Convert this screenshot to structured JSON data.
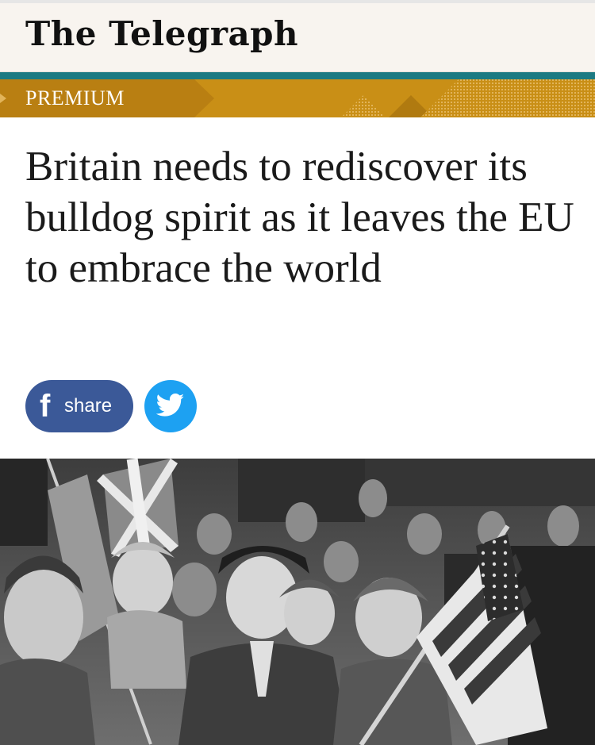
{
  "masthead": {
    "logo_text": "The Telegraph"
  },
  "badge": {
    "label": "PREMIUM"
  },
  "article": {
    "headline": "Britain needs to rediscover its bulldog spirit as it leaves the EU to embrace the world"
  },
  "share": {
    "facebook_icon": "f",
    "facebook_label": "share",
    "twitter_icon": "twitter-bird-icon"
  },
  "colors": {
    "masthead_bg": "#f8f4ef",
    "teal": "#1c7a82",
    "premium_gold": "#c98f16",
    "facebook_blue": "#3b5998",
    "twitter_blue": "#1da1f2"
  }
}
